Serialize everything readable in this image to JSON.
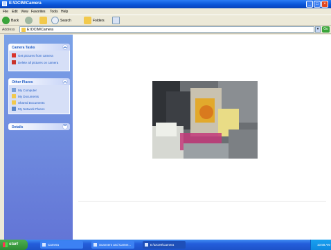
{
  "window": {
    "title": "E:\\DCIM\\Camera"
  },
  "menu": [
    "File",
    "Edit",
    "View",
    "Favorites",
    "Tools",
    "Help"
  ],
  "toolbar": {
    "back": "Back",
    "search": "Search",
    "folders": "Folders"
  },
  "address": {
    "label": "Address",
    "value": "E:\\DCIM\\Camera",
    "go": "Go"
  },
  "taskpane": {
    "camera_tasks": {
      "title": "Camera Tasks",
      "items": [
        "Get pictures from camera",
        "Delete all pictures on camera"
      ]
    },
    "other_places": {
      "title": "Other Places",
      "items": [
        "My Computer",
        "My Documents",
        "Shared Documents",
        "My Network Places"
      ]
    },
    "details": {
      "title": "Details"
    }
  },
  "taskbar": {
    "start": "start",
    "buttons": [
      "Camera",
      "Scanners and Camer...",
      "E:\\DCIM\\Camera"
    ],
    "clock": "10:58 AM"
  },
  "colors": {
    "title_blue": "#0a55d8",
    "taskpane_blue": "#6f8bdd",
    "start_green": "#3a9b3e"
  }
}
